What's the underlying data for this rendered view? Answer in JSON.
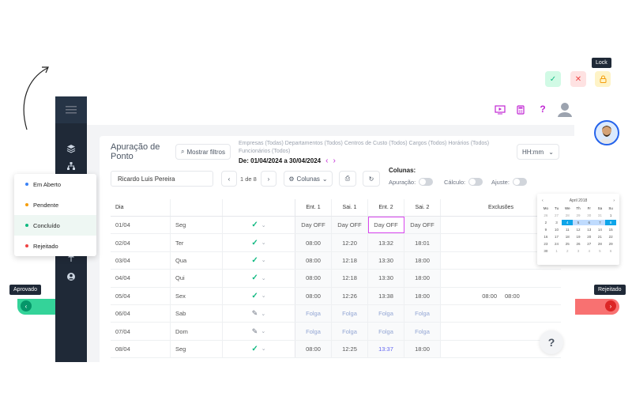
{
  "page": {
    "title": "Apuração de Ponto",
    "filter_button": "Mostrar filtros",
    "filters_text": "Empresas (Todas)  Departamentos (Todos)  Centros de Custo (Todos)  Cargos (Todos)  Horários (Todos)  Funcionários (Todos)",
    "period": "De: 01/04/2024 a 30/04/2024",
    "time_format": "HH:mm"
  },
  "controls": {
    "employee": "Ricardo Luis Pereira",
    "pager": "1 de 8",
    "columns_button": "Colunas",
    "columns_title": "Colunas:",
    "toggle_labels": [
      "Apuração:",
      "Cálculo:",
      "Ajuste:"
    ]
  },
  "table": {
    "headers": {
      "day": "Dia",
      "e1": "Ent. 1",
      "s1": "Sai. 1",
      "e2": "Ent. 2",
      "s2": "Sai. 2",
      "exc": "Exclusões"
    },
    "rows": [
      {
        "day": "01/04",
        "weekday": "Seg",
        "status": "check",
        "e1": "Day OFF",
        "s1": "Day OFF",
        "e2": "Day OFF",
        "s2": "Day OFF",
        "exc": [
          "",
          ""
        ]
      },
      {
        "day": "02/04",
        "weekday": "Ter",
        "status": "check",
        "e1": "08:00",
        "s1": "12:20",
        "e2": "13:32",
        "s2": "18:01",
        "exc": [
          "",
          ""
        ]
      },
      {
        "day": "03/04",
        "weekday": "Qua",
        "status": "check",
        "e1": "08:00",
        "s1": "12:18",
        "e2": "13:30",
        "s2": "18:00",
        "exc": [
          "",
          ""
        ]
      },
      {
        "day": "04/04",
        "weekday": "Qui",
        "status": "check",
        "e1": "08:00",
        "s1": "12:18",
        "e2": "13:30",
        "s2": "18:00",
        "exc": [
          "",
          ""
        ]
      },
      {
        "day": "05/04",
        "weekday": "Sex",
        "status": "check",
        "e1": "08:00",
        "s1": "12:26",
        "e2": "13:38",
        "s2": "18:00",
        "exc": [
          "08:00",
          "08:00"
        ]
      },
      {
        "day": "06/04",
        "weekday": "Sab",
        "status": "edit",
        "e1": "Folga",
        "s1": "Folga",
        "e2": "Folga",
        "s2": "Folga",
        "exc": [
          "",
          ""
        ]
      },
      {
        "day": "07/04",
        "weekday": "Dom",
        "status": "edit",
        "e1": "Folga",
        "s1": "Folga",
        "e2": "Folga",
        "s2": "Folga",
        "exc": [
          "",
          ""
        ]
      },
      {
        "day": "08/04",
        "weekday": "Seg",
        "status": "check",
        "e1": "08:00",
        "s1": "12:25",
        "e2": "13:37",
        "s2": "18:00",
        "exc": [
          "",
          ""
        ]
      }
    ]
  },
  "status_menu": [
    {
      "label": "Em Aberto",
      "color": "#3b82f6"
    },
    {
      "label": "Pendente",
      "color": "#f59e0b"
    },
    {
      "label": "Concluído",
      "color": "#10b981"
    },
    {
      "label": "Rejeitado",
      "color": "#ef4444"
    }
  ],
  "tooltips": {
    "lock": "Lock",
    "approved": "Aprovado",
    "rejected": "Rejeitado"
  },
  "calendar": {
    "month": "April 2018",
    "weekdays": [
      "Mo",
      "Tu",
      "We",
      "Th",
      "Fr",
      "Sa",
      "Su"
    ],
    "days": [
      "26",
      "27",
      "28",
      "29",
      "30",
      "31",
      "1",
      "2",
      "3",
      "4",
      "5",
      "6",
      "7",
      "8",
      "9",
      "10",
      "11",
      "12",
      "13",
      "14",
      "15",
      "16",
      "17",
      "18",
      "19",
      "20",
      "21",
      "22",
      "23",
      "24",
      "25",
      "26",
      "27",
      "28",
      "29",
      "30",
      "1",
      "2",
      "3",
      "4",
      "5",
      "6"
    ]
  },
  "colors": {
    "accent": "#c026d3",
    "sidebar": "#1f2937",
    "check": "#10b981"
  }
}
